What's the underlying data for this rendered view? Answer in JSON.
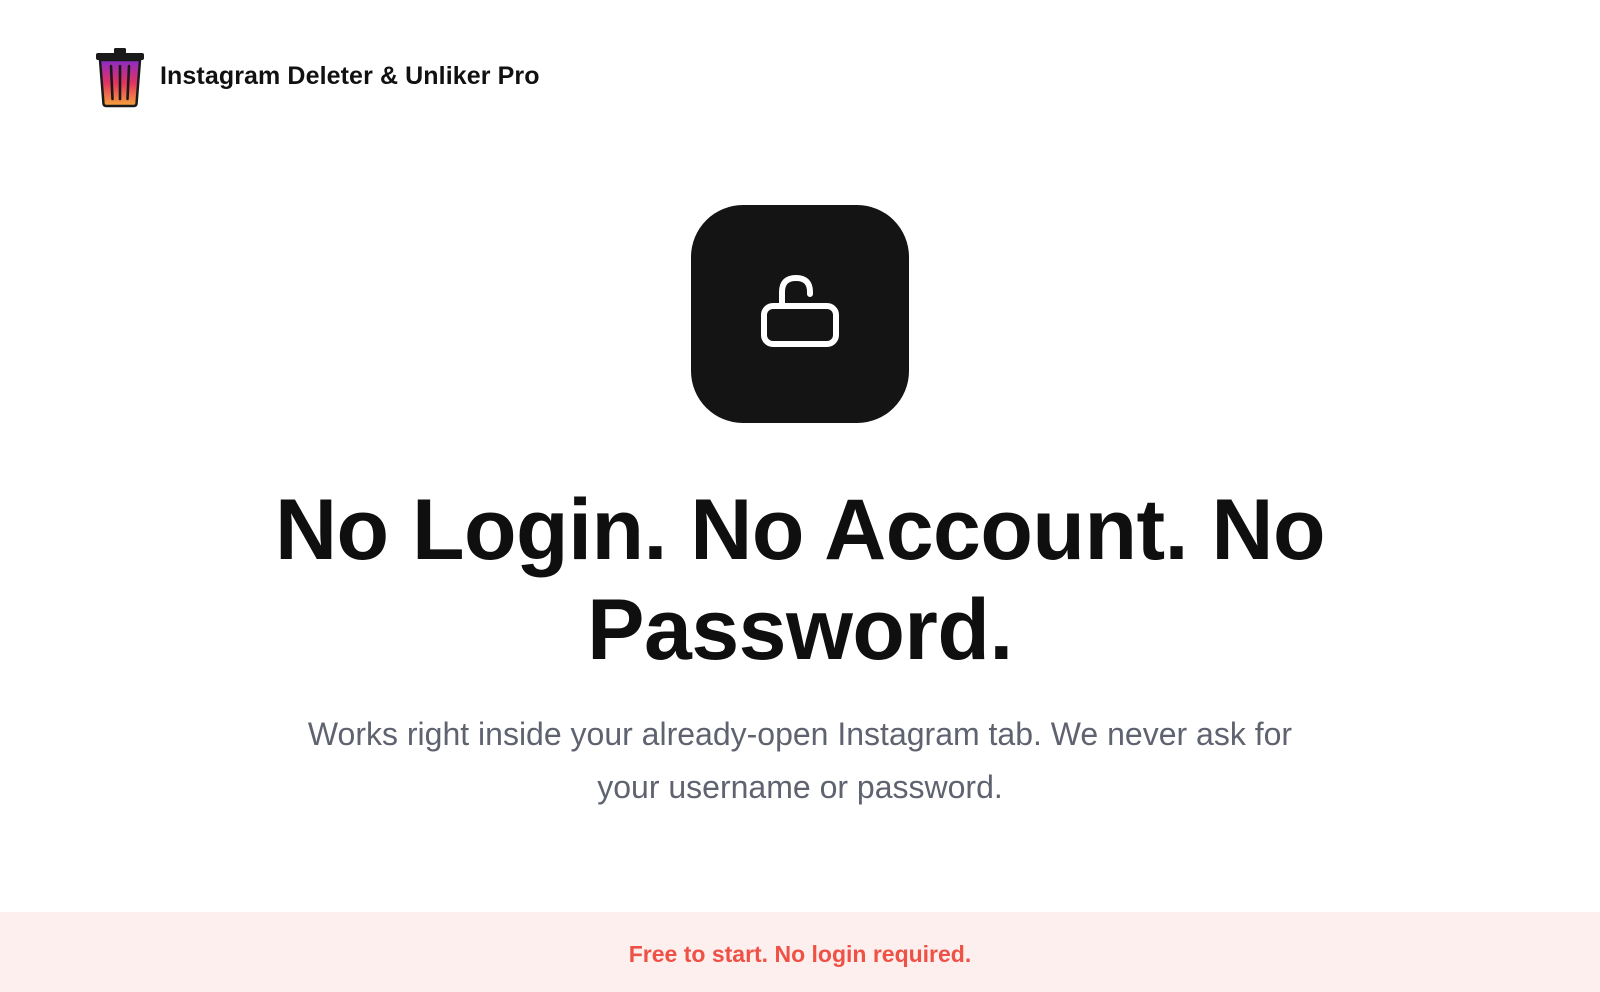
{
  "header": {
    "logo_icon": "trash-can-icon",
    "brand_name": "Instagram Deleter & Unliker Pro"
  },
  "hero": {
    "icon": "unlock-icon",
    "headline": "No Login. No Account. No Password.",
    "subtext": "Works right inside your already-open Instagram tab. We never ask for your username or password."
  },
  "banner": {
    "text": "Free to start. No login required."
  },
  "colors": {
    "background": "#ffffff",
    "icon_box": "#141414",
    "headline": "#0f0f0f",
    "subtext": "#5f6370",
    "banner_bg": "#fdefee",
    "banner_text": "#ef5146",
    "logo_gradient_top": "#8a2bc9",
    "logo_gradient_mid": "#e2335f",
    "logo_gradient_bottom": "#f7a43a"
  }
}
